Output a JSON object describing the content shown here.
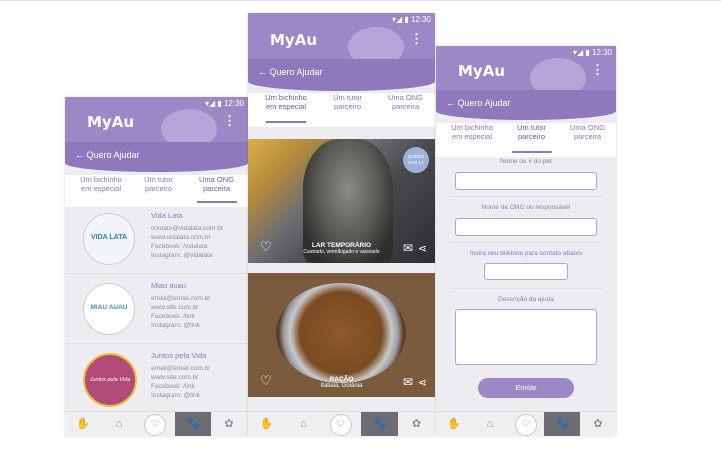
{
  "app": {
    "logo": "MyAu",
    "status_time": "12:30",
    "status_icons": "▾◢ ▮",
    "menu_icon": "⋮",
    "back_title": "← Quero Ajudar"
  },
  "tabs": [
    {
      "line1": "Um bichinho",
      "line2": "em especial"
    },
    {
      "line1": "Um tutor",
      "line2": "parceiro"
    },
    {
      "line1": "Uma ONG",
      "line2": "parceira"
    }
  ],
  "orgs": [
    {
      "name": "Vida Lata",
      "logo_text": "VIDA LATA",
      "email": "contato@vidalata.com.br",
      "site": "www.vidalata.com.br",
      "facebook": "Facebook: /vidalata",
      "instagram": "Instagram: @vidalata"
    },
    {
      "name": "Miau auau",
      "logo_text": "MIAU AUAU",
      "email": "email@email.com.br",
      "site": "www.site.com.br",
      "facebook": "Facebook: /link",
      "instagram": "Instagram: @link"
    },
    {
      "name": "Juntos pela Vida",
      "logo_text": "Juntos pela Vida",
      "email": "email@email.com.br",
      "site": "www.site.com.br",
      "facebook": "Facebook: /link",
      "instagram": "Instagram: @link"
    }
  ],
  "cards": [
    {
      "badge_line1": "QUERO",
      "badge_line2": "DAR LT",
      "title": "LAR TEMPORÁRIO",
      "subtitle": "Castrado, vermifugado e vacinado"
    },
    {
      "title": "RAÇÃO",
      "subtitle": "Itatiaia, Goiânia"
    }
  ],
  "form": {
    "label_pet": "Nome ou # do pet",
    "label_ong": "Nome da ONG ou responsável",
    "label_phone": "Insira seu telefone para contato abaixo",
    "label_desc": "Descrição da ajuda",
    "send": "Enviar"
  },
  "icons": {
    "heart": "♡",
    "mail": "✉",
    "share": "⋖",
    "nav": [
      "✋",
      "⌂",
      "♡",
      "🐾",
      "✿"
    ]
  }
}
